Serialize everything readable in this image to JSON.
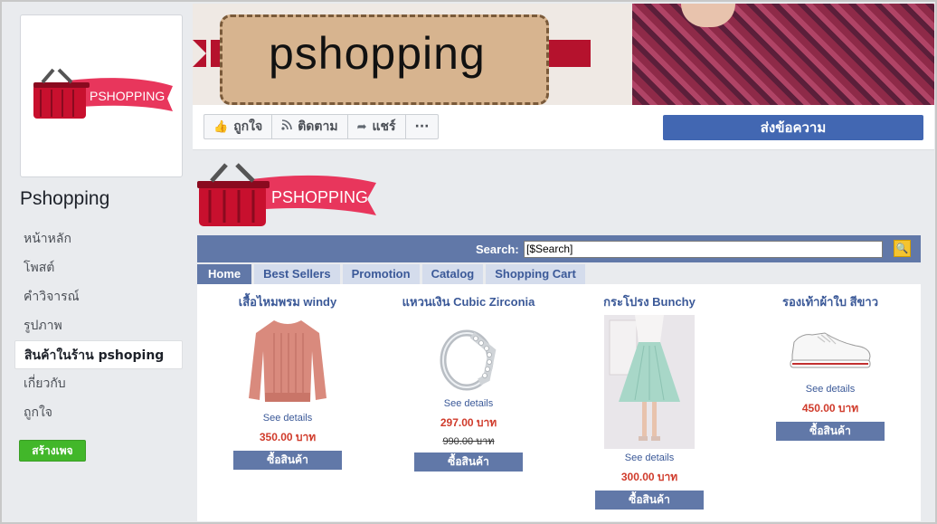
{
  "sidebar": {
    "page_name": "Pshopping",
    "items": [
      {
        "label": "หน้าหลัก"
      },
      {
        "label": "โพสต์"
      },
      {
        "label": "คำวิจารณ์"
      },
      {
        "label": "รูปภาพ"
      },
      {
        "label": "สินค้าในร้าน pshoping"
      },
      {
        "label": "เกี่ยวกับ"
      },
      {
        "label": "ถูกใจ"
      }
    ],
    "create_page_label": "สร้างเพจ"
  },
  "logo": {
    "text": "PSHOPPING"
  },
  "cover": {
    "title": "pshopping"
  },
  "actions": {
    "like_label": "ถูกใจ",
    "follow_label": "ติดตาม",
    "share_label": "แชร์",
    "more_label": "···",
    "message_label": "ส่งข้อความ"
  },
  "shop": {
    "search_label": "Search:",
    "search_value": "[$Search]",
    "tabs": [
      {
        "label": "Home"
      },
      {
        "label": "Best Sellers"
      },
      {
        "label": "Promotion"
      },
      {
        "label": "Catalog"
      },
      {
        "label": "Shopping Cart"
      }
    ],
    "products": [
      {
        "title": "เสื้อไหมพรม windy",
        "details": "See details",
        "price": "350.00 บาท",
        "old_price": "",
        "buy": "ซื้อสินค้า"
      },
      {
        "title": "แหวนเงิน Cubic Zirconia",
        "details": "See details",
        "price": "297.00 บาท",
        "old_price": "990.00 บาท",
        "buy": "ซื้อสินค้า"
      },
      {
        "title": "กระโปรง Bunchy",
        "details": "See details",
        "price": "300.00 บาท",
        "old_price": "",
        "buy": "ซื้อสินค้า"
      },
      {
        "title": "รองเท้าผ้าใบ สีขาว",
        "details": "See details",
        "price": "450.00 บาท",
        "old_price": "",
        "buy": "ซื้อสินค้า"
      }
    ]
  },
  "colors": {
    "facebook_blue": "#4267b2",
    "shop_bar": "#6178a8",
    "price_red": "#d03b2b",
    "create_green": "#42b72a",
    "logo_red": "#c8102e"
  }
}
